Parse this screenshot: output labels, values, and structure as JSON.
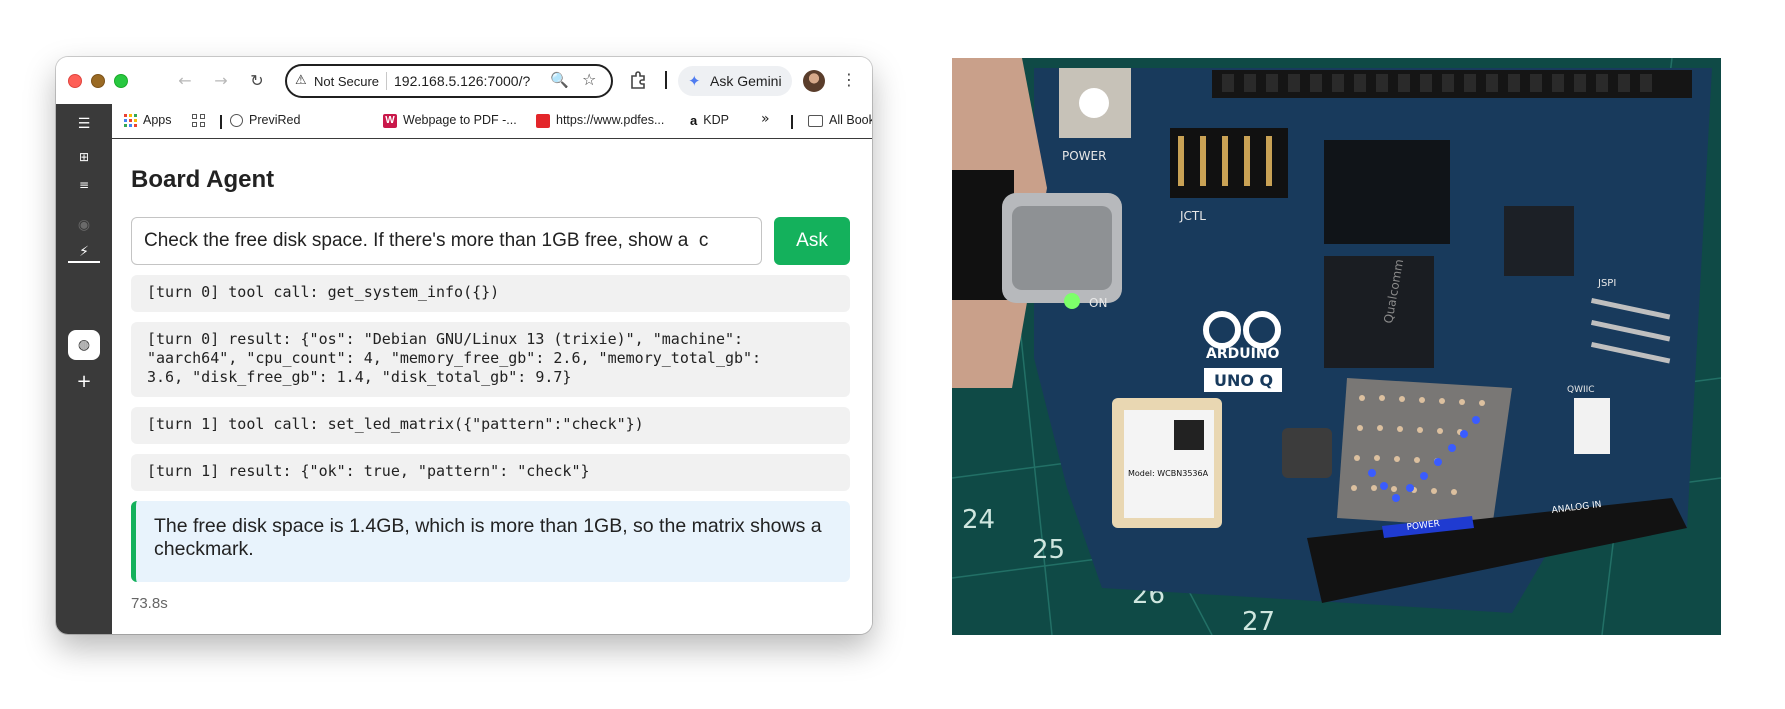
{
  "browser": {
    "nav": {
      "back": "←",
      "forward": "→",
      "reload": "↻"
    },
    "omnibox": {
      "warning_icon": "⚠",
      "security_label": "Not Secure",
      "url": "192.168.5.126:7000/?",
      "zoom_icon": "🔍",
      "star_icon": "☆"
    },
    "gemini_label": "Ask Gemini",
    "menu_icon": "⋮"
  },
  "bookmarks": {
    "apps": "Apps",
    "items": [
      "PreviRed",
      "Webpage to PDF -...",
      "https://www.pdfes...",
      "KDP"
    ],
    "overflow": "»",
    "all": "All Bookmarks"
  },
  "sidebar": {
    "icons": [
      "sidebar-toggle-icon",
      "tab-groups-icon",
      "reading-list-icon",
      "history-icon",
      "extension-icon",
      "web-icon",
      "add-icon"
    ]
  },
  "page": {
    "title": "Board Agent",
    "prompt_value": "Check the free disk space. If there's more than 1GB free, show a  c",
    "ask_label": "Ask",
    "log": [
      "[turn 0] tool call: get_system_info({})",
      "[turn 0] result: {\"os\": \"Debian GNU/Linux 13 (trixie)\", \"machine\":\n\"aarch64\", \"cpu_count\": 4, \"memory_free_gb\": 2.6, \"memory_total_gb\":\n3.6, \"disk_free_gb\": 1.4, \"disk_total_gb\": 9.7}",
      "[turn 1] tool call: set_led_matrix({\"pattern\":\"check\"})",
      "[turn 1] result: {\"ok\": true, \"pattern\": \"check\"}"
    ],
    "answer": "The free disk space is 1.4GB, which is more than 1GB, so the matrix shows a checkmark.",
    "elapsed": "73.8s"
  },
  "photo": {
    "board_labels": {
      "power": "POWER",
      "jctl": "JCTL",
      "on": "ON",
      "brand": "ARDUINO",
      "model": "UNO Q",
      "qwiic": "QWIIC",
      "jspi": "JSPI",
      "module": "Model:\nWCBN3536A",
      "chip": "Qualcomm",
      "header_power": "POWER",
      "header_analog": "ANALOG IN"
    },
    "colors": {
      "mat": "#0f4a46",
      "board": "#183a5c",
      "led_on": "#3a5cff",
      "led_off": "#e7c9a4"
    }
  }
}
